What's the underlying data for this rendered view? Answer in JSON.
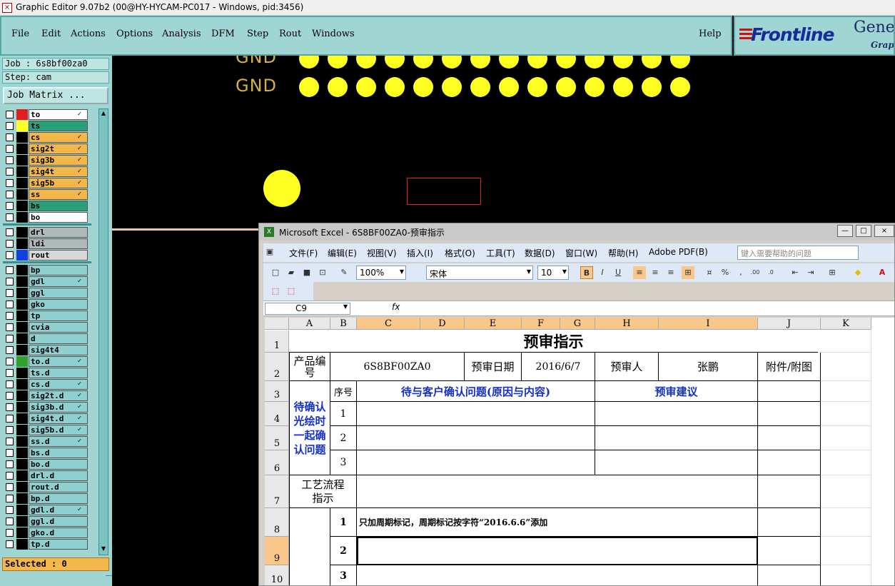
{
  "app": {
    "title": "Graphic Editor 9.07b2 (00@HY-HYCAM-PC017 - Windows, pid:3456)"
  },
  "menu": [
    "File",
    "Edit",
    "Actions",
    "Options",
    "Analysis",
    "DFM",
    "Step",
    "Rout",
    "Windows"
  ],
  "menu_help": "Help",
  "logo": {
    "brand": "Frontline",
    "product": "Genes",
    "sub": "Graph"
  },
  "job": {
    "job_label": "Job : 6s8bf00za0",
    "step_label": "Step: cam",
    "matrix_button": "Job Matrix ..."
  },
  "layers": [
    {
      "name": "to",
      "bg": "#ffffff",
      "swatch": "#e02020",
      "mark": "✓"
    },
    {
      "name": "ts",
      "bg": "#2aa07a",
      "swatch": "#ffff22",
      "mark": ""
    },
    {
      "name": "cs",
      "bg": "#f4b84a",
      "swatch": "#000000",
      "mark": "✓"
    },
    {
      "name": "sig2t",
      "bg": "#f4b84a",
      "swatch": "#000000",
      "mark": "✓"
    },
    {
      "name": "sig3b",
      "bg": "#f4b84a",
      "swatch": "#000000",
      "mark": "✓"
    },
    {
      "name": "sig4t",
      "bg": "#f4b84a",
      "swatch": "#000000",
      "mark": "✓"
    },
    {
      "name": "sig5b",
      "bg": "#f4b84a",
      "swatch": "#000000",
      "mark": "✓"
    },
    {
      "name": "ss",
      "bg": "#f4b84a",
      "swatch": "#000000",
      "mark": "✓"
    },
    {
      "name": "bs",
      "bg": "#2aa07a",
      "swatch": "#000000",
      "mark": ""
    },
    {
      "name": "bo",
      "bg": "#ffffff",
      "swatch": "#000000",
      "mark": ""
    },
    {
      "name": "drl",
      "bg": "#b0b8b8",
      "swatch": "#000000",
      "mark": ""
    },
    {
      "name": "ldi",
      "bg": "#b0b8b8",
      "swatch": "#000000",
      "mark": ""
    },
    {
      "name": "rout",
      "bg": "#d8d8d8",
      "swatch": "#1040e0",
      "mark": ""
    },
    {
      "name": "bp",
      "bg": "#8fd0ce",
      "swatch": "#000000",
      "mark": ""
    },
    {
      "name": "gdl",
      "bg": "#8fd0ce",
      "swatch": "#000000",
      "mark": "✓"
    },
    {
      "name": "ggl",
      "bg": "#8fd0ce",
      "swatch": "#000000",
      "mark": ""
    },
    {
      "name": "gko",
      "bg": "#8fd0ce",
      "swatch": "#000000",
      "mark": ""
    },
    {
      "name": "tp",
      "bg": "#8fd0ce",
      "swatch": "#000000",
      "mark": ""
    },
    {
      "name": "cvia",
      "bg": "#8fd0ce",
      "swatch": "#000000",
      "mark": ""
    },
    {
      "name": "d",
      "bg": "#8fd0ce",
      "swatch": "#000000",
      "mark": ""
    },
    {
      "name": "sig4t4",
      "bg": "#8fd0ce",
      "swatch": "#000000",
      "mark": ""
    },
    {
      "name": "to.d",
      "bg": "#8fd0ce",
      "swatch": "#30a030",
      "mark": "✓"
    },
    {
      "name": "ts.d",
      "bg": "#8fd0ce",
      "swatch": "#000000",
      "mark": ""
    },
    {
      "name": "cs.d",
      "bg": "#8fd0ce",
      "swatch": "#000000",
      "mark": "✓"
    },
    {
      "name": "sig2t.d",
      "bg": "#8fd0ce",
      "swatch": "#000000",
      "mark": "✓"
    },
    {
      "name": "sig3b.d",
      "bg": "#8fd0ce",
      "swatch": "#000000",
      "mark": "✓"
    },
    {
      "name": "sig4t.d",
      "bg": "#8fd0ce",
      "swatch": "#000000",
      "mark": "✓"
    },
    {
      "name": "sig5b.d",
      "bg": "#8fd0ce",
      "swatch": "#000000",
      "mark": "✓"
    },
    {
      "name": "ss.d",
      "bg": "#8fd0ce",
      "swatch": "#000000",
      "mark": "✓"
    },
    {
      "name": "bs.d",
      "bg": "#8fd0ce",
      "swatch": "#000000",
      "mark": ""
    },
    {
      "name": "bo.d",
      "bg": "#8fd0ce",
      "swatch": "#000000",
      "mark": ""
    },
    {
      "name": "drl.d",
      "bg": "#8fd0ce",
      "swatch": "#000000",
      "mark": ""
    },
    {
      "name": "rout.d",
      "bg": "#8fd0ce",
      "swatch": "#000000",
      "mark": ""
    },
    {
      "name": "bp.d",
      "bg": "#8fd0ce",
      "swatch": "#000000",
      "mark": ""
    },
    {
      "name": "gdl.d",
      "bg": "#8fd0ce",
      "swatch": "#000000",
      "mark": "✓"
    },
    {
      "name": "ggl.d",
      "bg": "#8fd0ce",
      "swatch": "#000000",
      "mark": ""
    },
    {
      "name": "gko.d",
      "bg": "#8fd0ce",
      "swatch": "#000000",
      "mark": ""
    },
    {
      "name": "tp.d",
      "bg": "#8fd0ce",
      "swatch": "#000000",
      "mark": ""
    }
  ],
  "selected": "Selected : 0",
  "canvas": {
    "gnd_label": "GND"
  },
  "excel": {
    "title": "Microsoft Excel - 6S8BF00ZA0-预审指示",
    "menu": [
      "文件(F)",
      "编辑(E)",
      "视图(V)",
      "插入(I)",
      "格式(O)",
      "工具(T)",
      "数据(D)",
      "窗口(W)",
      "帮助(H)",
      "Adobe PDF(B)"
    ],
    "help_placeholder": "键入需要帮助的问题",
    "zoom": "100%",
    "font": "宋体",
    "font_size": "10",
    "name_box": "C9",
    "fx": "fx",
    "columns": [
      "A",
      "B",
      "C",
      "D",
      "E",
      "F",
      "G",
      "H",
      "I",
      "J",
      "K"
    ],
    "rows": [
      "1",
      "2",
      "3",
      "4",
      "5",
      "6",
      "7",
      "8",
      "9",
      "10"
    ],
    "sheet": {
      "title": "预审指示",
      "product_no_label": "产品编号",
      "product_no": "6S8BF00ZA0",
      "review_date_label": "预审日期",
      "review_date": "2016/6/7",
      "reviewer_label": "预审人",
      "reviewer": "张鹏",
      "attach_label": "附件/附图",
      "seq_label": "序号",
      "issue_label": "待与客户确认问题(原因与内容)",
      "suggest_label": "预审建议",
      "confirm_label": "待确认光绘时一起确认问题",
      "seq1": "1",
      "seq2": "2",
      "seq3": "3",
      "process_label": "工艺流程指示",
      "p1": "1",
      "p2": "2",
      "p3": "3",
      "instruction1": "只加周期标记，周期标记按字符“2016.6.6”添加"
    }
  },
  "colors": {
    "gui_teal": "#9fd6d4",
    "pad_yellow": "#ffff22",
    "blue_text": "#1530c8"
  }
}
